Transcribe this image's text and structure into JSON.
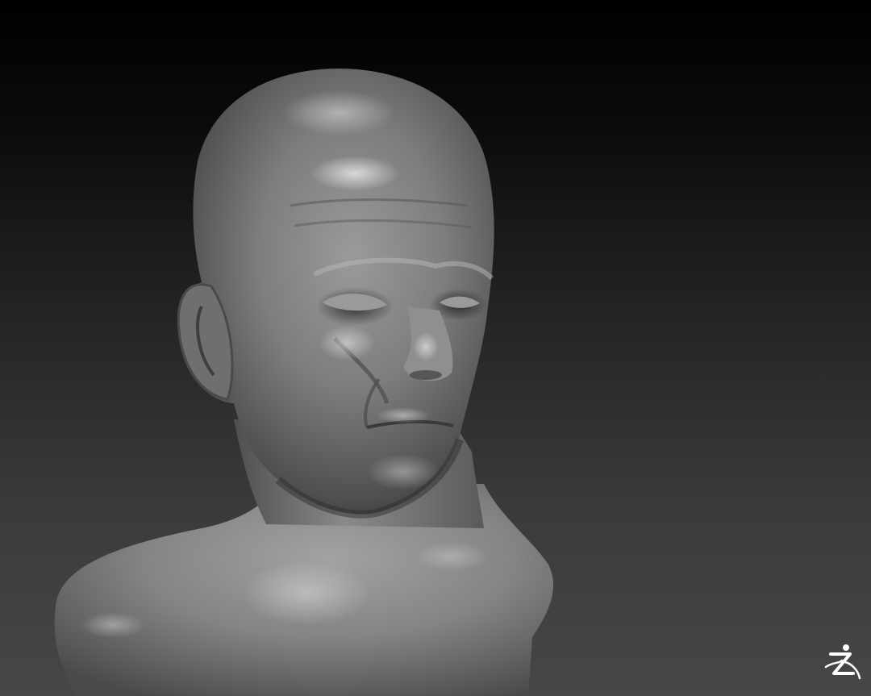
{
  "app": {
    "name": "ZBrush",
    "viewport_background": "#2a2a2a",
    "mesh_color": "#8c8c8c"
  },
  "viewport": {
    "subject": "sculpted-head-bust",
    "logo_icon": "zbrush-logo-icon"
  }
}
